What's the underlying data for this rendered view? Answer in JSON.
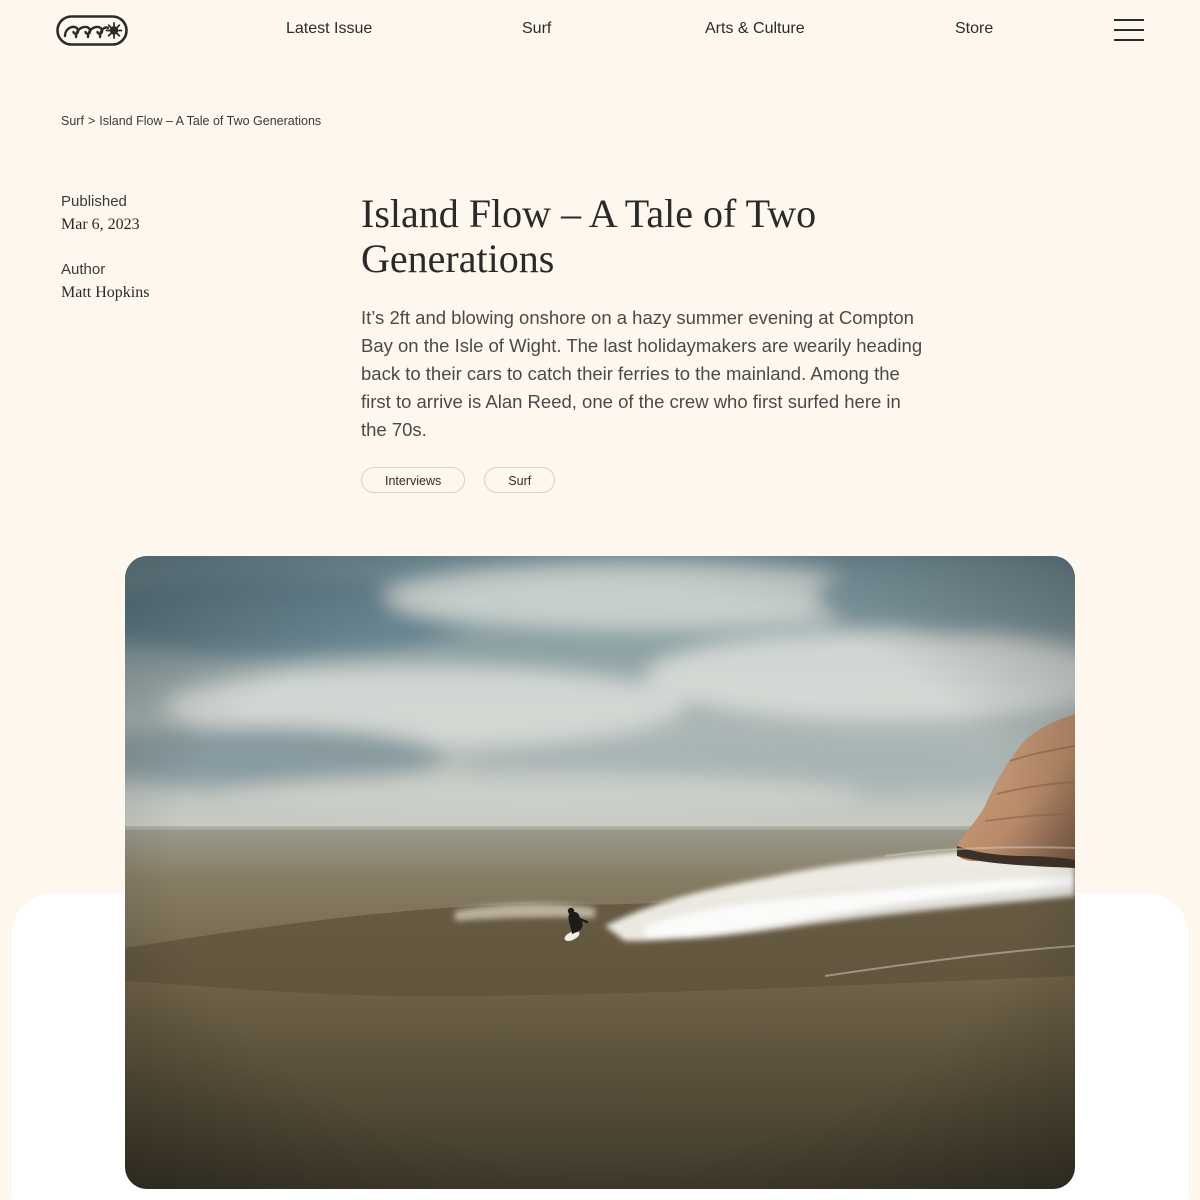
{
  "header": {
    "logo": {
      "icon": "wave-sun-logo-icon",
      "stroke_color": "#2b2b2b"
    },
    "nav": [
      {
        "label": "Latest Issue"
      },
      {
        "label": "Surf"
      },
      {
        "label": "Arts & Culture"
      },
      {
        "label": "Store"
      }
    ],
    "menu": {
      "icon": "hamburger-menu-icon"
    }
  },
  "breadcrumb": {
    "parent": "Surf",
    "separator": ">",
    "current": "Island Flow – A Tale of Two Generations"
  },
  "meta": {
    "published_label": "Published",
    "published_date": "Mar 6, 2023",
    "author_label": "Author",
    "author_name": "Matt Hopkins"
  },
  "article": {
    "title": "Island Flow – A Tale of Two Generations",
    "lede": "It’s 2ft and blowing onshore on a hazy summer evening at Compton Bay on the Isle of Wight. The last holidaymakers are wearily heading back to their cars to catch their ferries to the mainland. Among the first to arrive is Alan Reed, one of the crew who first surfed here in the 70s.",
    "tags": [
      {
        "label": "Interviews"
      },
      {
        "label": "Surf"
      }
    ]
  },
  "hero_image": {
    "subject": "surfer-on-wave-photo",
    "colors": {
      "sky": "#8fa3a6",
      "sea": "#6d6046",
      "cliff": "#b88a68",
      "foam": "#f2f0ea"
    }
  },
  "theme": {
    "background": "#fdf7ee",
    "panel": "#ffffff",
    "text": "#2b2b2b",
    "tag_border": "#d9d2c6"
  }
}
